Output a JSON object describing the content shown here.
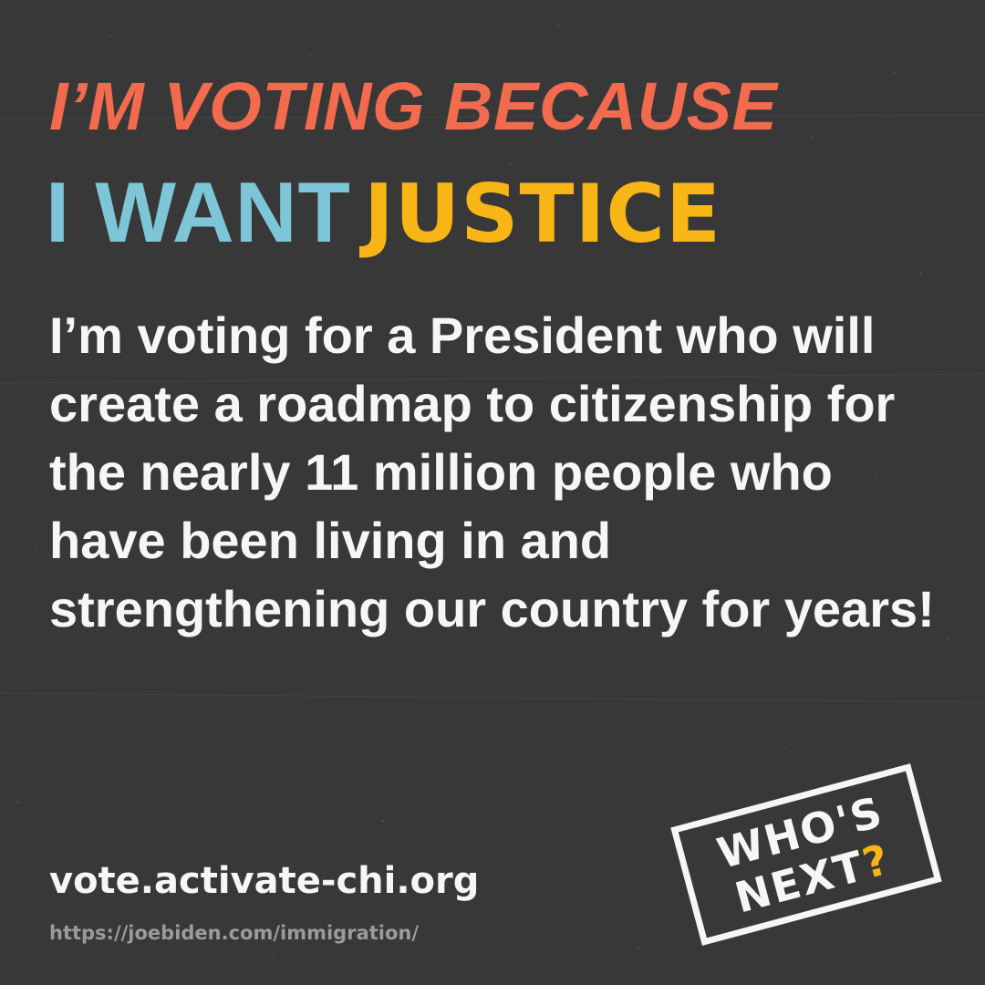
{
  "headline": {
    "line1": "I’M VOTING BECAUSE",
    "line2_part1": "I WANT",
    "line2_part2": "JUSTICE"
  },
  "body": {
    "text": "I’m voting for a President who will create a roadmap to citizenship for the nearly 11 million people who have been living in and strengthening our country for years!"
  },
  "footer": {
    "site_url": "vote.activate-chi.org",
    "source_url": "https://joebiden.com/immigration/"
  },
  "stamp": {
    "line1": "WHO'S",
    "line2_main": "NEXT",
    "line2_mark": "?"
  },
  "colors": {
    "background": "#383838",
    "headline_orange": "#f26b4e",
    "headline_blue": "#7cc6d8",
    "headline_yellow": "#f8b616",
    "body_text": "#f6f6f6",
    "muted_text": "#9b9b9b"
  }
}
